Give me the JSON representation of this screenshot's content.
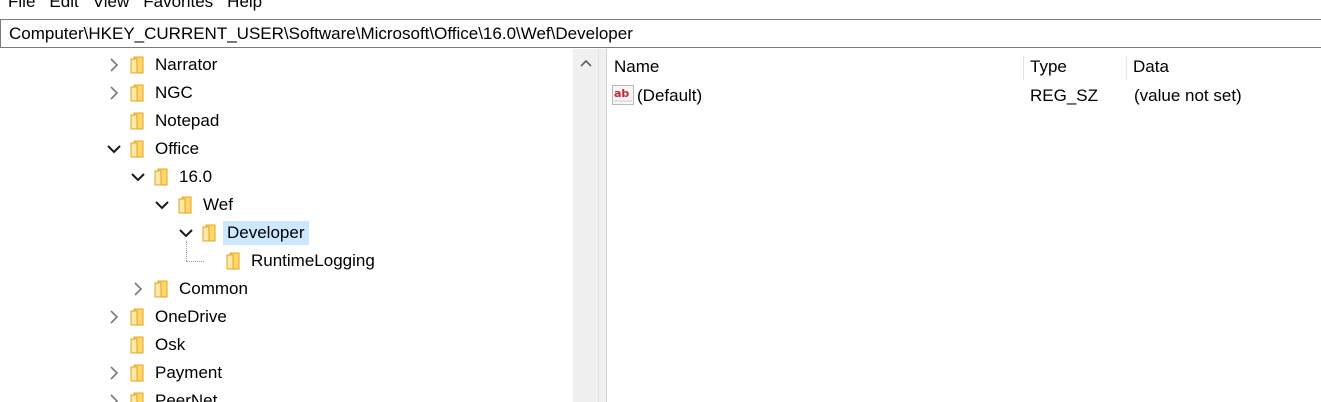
{
  "menu": {
    "items": [
      "File",
      "Edit",
      "View",
      "Favorites",
      "Help"
    ]
  },
  "address": {
    "path": "Computer\\HKEY_CURRENT_USER\\Software\\Microsoft\\Office\\16.0\\Wef\\Developer"
  },
  "tree": {
    "items": [
      {
        "label": "Narrator",
        "state": "collapsed"
      },
      {
        "label": "NGC",
        "state": "collapsed"
      },
      {
        "label": "Notepad",
        "state": "leaf"
      },
      {
        "label": "Office",
        "state": "expanded"
      },
      {
        "label": "16.0",
        "state": "expanded"
      },
      {
        "label": "Wef",
        "state": "expanded"
      },
      {
        "label": "Developer",
        "state": "expanded",
        "selected": true
      },
      {
        "label": "RuntimeLogging",
        "state": "leaf"
      },
      {
        "label": "Common",
        "state": "collapsed"
      },
      {
        "label": "OneDrive",
        "state": "collapsed"
      },
      {
        "label": "Osk",
        "state": "leaf"
      },
      {
        "label": "Payment",
        "state": "collapsed"
      },
      {
        "label": "PeerNet",
        "state": "collapsed"
      }
    ]
  },
  "list": {
    "columns": {
      "name": "Name",
      "type": "Type",
      "data": "Data"
    },
    "rows": [
      {
        "icon": "string-value-icon",
        "name": "(Default)",
        "type": "REG_SZ",
        "data": "(value not set)"
      }
    ]
  },
  "colors": {
    "selection": "#cce8ff",
    "folder_fill": "#ffd767",
    "folder_edge": "#e0a526",
    "value_icon_red": "#c1272d"
  }
}
